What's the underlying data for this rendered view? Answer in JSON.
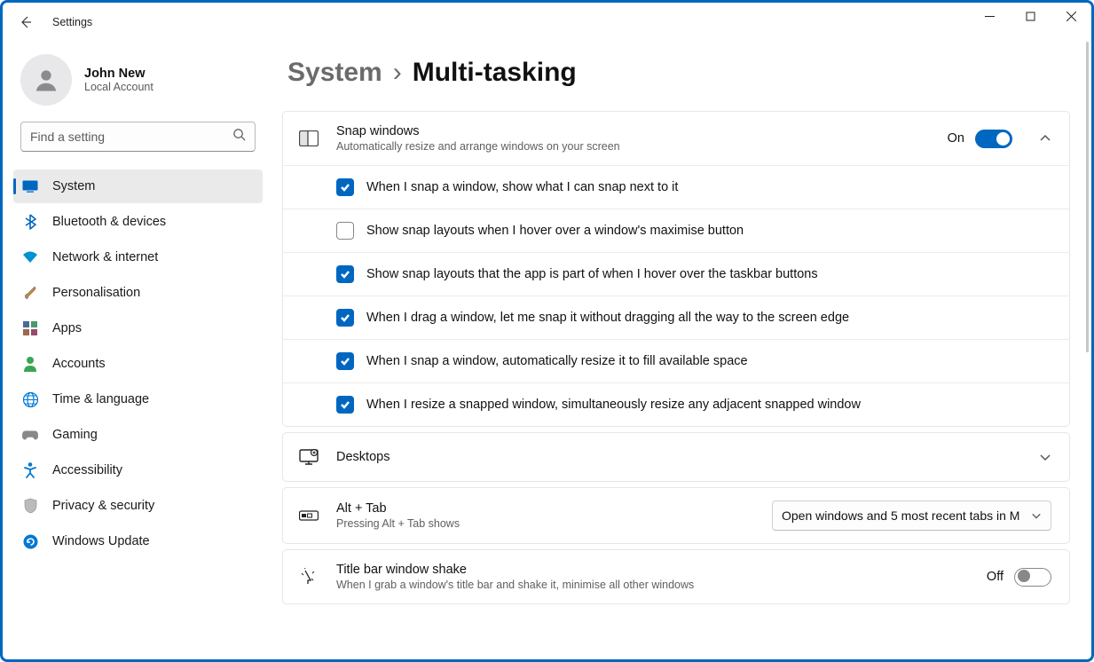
{
  "window": {
    "title": "Settings"
  },
  "user": {
    "name": "John New",
    "subtitle": "Local Account"
  },
  "search": {
    "placeholder": "Find a setting"
  },
  "nav": [
    {
      "id": "system",
      "label": "System",
      "active": true,
      "icon": "system"
    },
    {
      "id": "bluetooth",
      "label": "Bluetooth & devices",
      "active": false,
      "icon": "bluetooth"
    },
    {
      "id": "network",
      "label": "Network & internet",
      "active": false,
      "icon": "wifi"
    },
    {
      "id": "personalisation",
      "label": "Personalisation",
      "active": false,
      "icon": "brush"
    },
    {
      "id": "apps",
      "label": "Apps",
      "active": false,
      "icon": "apps"
    },
    {
      "id": "accounts",
      "label": "Accounts",
      "active": false,
      "icon": "person"
    },
    {
      "id": "time",
      "label": "Time & language",
      "active": false,
      "icon": "globe"
    },
    {
      "id": "gaming",
      "label": "Gaming",
      "active": false,
      "icon": "gamepad"
    },
    {
      "id": "accessibility",
      "label": "Accessibility",
      "active": false,
      "icon": "accessibility"
    },
    {
      "id": "privacy",
      "label": "Privacy & security",
      "active": false,
      "icon": "shield"
    },
    {
      "id": "update",
      "label": "Windows Update",
      "active": false,
      "icon": "update"
    }
  ],
  "breadcrumb": {
    "parent": "System",
    "current": "Multi-tasking"
  },
  "snap": {
    "title": "Snap windows",
    "subtitle": "Automatically resize and arrange windows on your screen",
    "state_label": "On",
    "state_on": true,
    "options": [
      {
        "checked": true,
        "label": "When I snap a window, show what I can snap next to it"
      },
      {
        "checked": false,
        "label": "Show snap layouts when I hover over a window's maximise button"
      },
      {
        "checked": true,
        "label": "Show snap layouts that the app is part of when I hover over the taskbar buttons"
      },
      {
        "checked": true,
        "label": "When I drag a window, let me snap it without dragging all the way to the screen edge"
      },
      {
        "checked": true,
        "label": "When I snap a window, automatically resize it to fill available space"
      },
      {
        "checked": true,
        "label": "When I resize a snapped window, simultaneously resize any adjacent snapped window"
      }
    ]
  },
  "desktops": {
    "title": "Desktops"
  },
  "alttab": {
    "title": "Alt + Tab",
    "subtitle": "Pressing Alt + Tab shows",
    "selected": "Open windows and 5 most recent tabs in M"
  },
  "shake": {
    "title": "Title bar window shake",
    "subtitle": "When I grab a window's title bar and shake it, minimise all other windows",
    "state_label": "Off",
    "state_on": false
  }
}
